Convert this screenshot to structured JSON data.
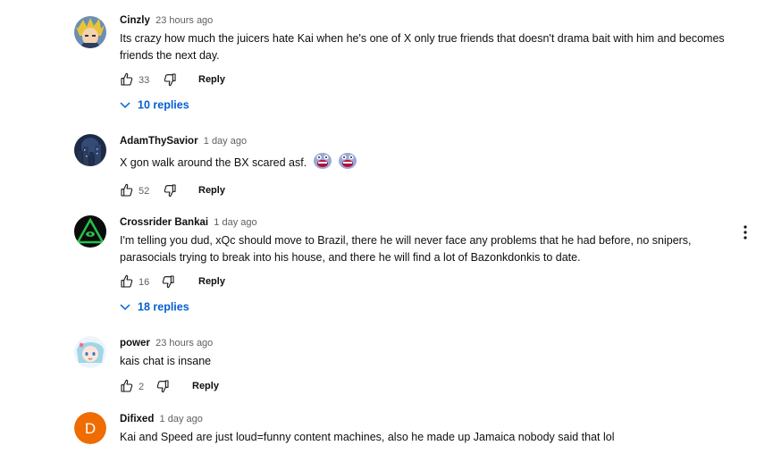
{
  "comments": [
    {
      "author": "Cinzly",
      "time": "23 hours ago",
      "text_line1": "Its crazy how much the juicers hate Kai when he's one of X only true friends that doesn't drama bait with him and becomes",
      "text_line2": "friends the next day.",
      "likes": "33",
      "reply_label": "Reply",
      "replies_label": "10 replies",
      "avatar_icon": "anime-avatar-icon"
    },
    {
      "author": "AdamThySavior",
      "time": "1 day ago",
      "text_line1": "X gon walk around the BX scared asf.",
      "likes": "52",
      "reply_label": "Reply",
      "avatar_icon": "city-night-avatar-icon"
    },
    {
      "author": "Crossrider Bankai",
      "time": "1 day ago",
      "text_line1": "I'm telling you dud, xQc should move to Brazil, there he will never face any problems that he had before, no snipers,",
      "text_line2": "parasocials trying to break into his house, and there he will find a lot of Bazonkdonkis to date.",
      "likes": "16",
      "reply_label": "Reply",
      "replies_label": "18 replies",
      "avatar_icon": "green-triangle-eye-avatar-icon"
    },
    {
      "author": "power",
      "time": "23 hours ago",
      "text_line1": "kais chat is insane",
      "likes": "2",
      "reply_label": "Reply",
      "avatar_icon": "anime-girl-avatar-icon"
    },
    {
      "author": "Difixed",
      "time": "1 day ago",
      "text_line1": "Kai and Speed are just loud=funny content machines, also he made up Jamaica nobody said that lol",
      "avatar_letter": "D",
      "avatar_color": "#ef6c00"
    }
  ],
  "colors": {
    "link_blue": "#065fd4",
    "secondary_text": "#606060",
    "primary_text": "#0f0f0f"
  }
}
